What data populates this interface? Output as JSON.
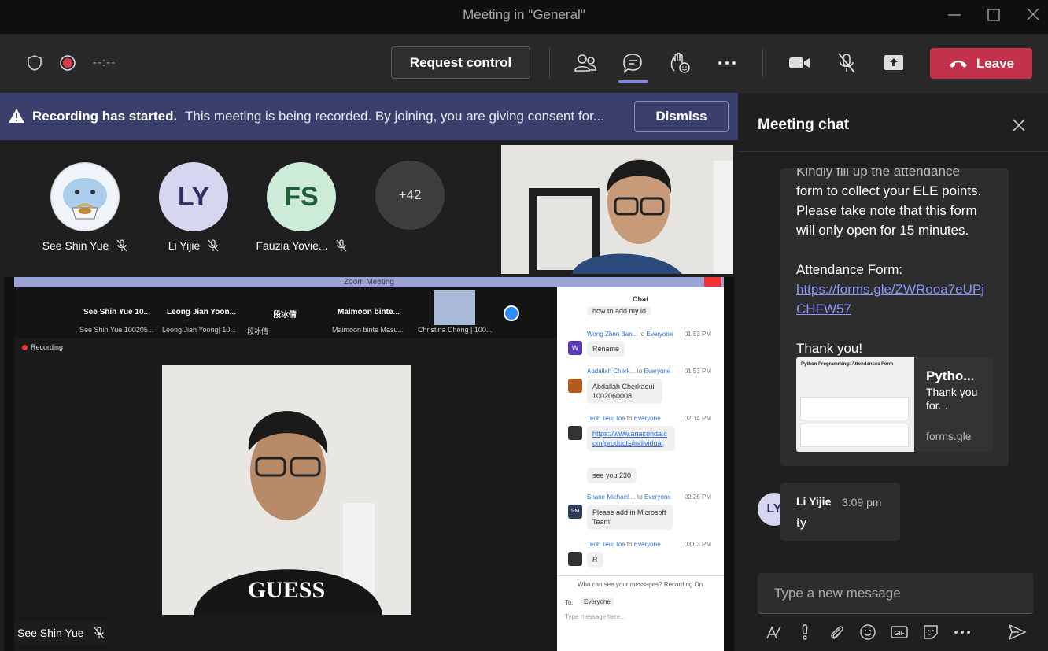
{
  "window": {
    "title": "Meeting in \"General\""
  },
  "toolbar": {
    "timer": "--:--",
    "request_control_label": "Request control",
    "leave_label": "Leave"
  },
  "banner": {
    "title": "Recording has started.",
    "message": "This meeting is being recorded. By joining, you are giving consent for...",
    "dismiss_label": "Dismiss"
  },
  "participants": [
    {
      "name": "See Shin Yue",
      "initials": "",
      "color": "#e9eef7"
    },
    {
      "name": "Li Yijie",
      "initials": "LY",
      "color": "#d7d6f0"
    },
    {
      "name": "Fauzia Yovie...",
      "initials": "FS",
      "color": "#cdebd9"
    },
    {
      "name": "",
      "initials": "+42",
      "color": "#3d3d3d"
    }
  ],
  "shared_screen": {
    "window_title": "Zoom Meeting",
    "recording_label": "Recording",
    "strip": [
      {
        "name": "See Shin Yue 10...",
        "sub": "See Shin Yue 100205..."
      },
      {
        "name": "Leong Jian Yoon...",
        "sub": "Leong Jian Yoong| 10..."
      },
      {
        "name": "段冰倩",
        "sub": "段冰倩"
      },
      {
        "name": "Maimoon binte...",
        "sub": "Maimoon binte Masu..."
      },
      {
        "name": "",
        "sub": "Christina Chong | 100..."
      }
    ],
    "chat": {
      "header": "Chat",
      "top_partial": "how to add my id",
      "messages": [
        {
          "sender": "Wong Zhen Ban...",
          "to": "to",
          "target": "Everyone",
          "time": "01:53 PM",
          "text": "Rename"
        },
        {
          "sender": "Abdallah Cherk...",
          "to": "to",
          "target": "Everyone",
          "time": "01:53 PM",
          "text": "Abdallah Cherkaoui 1002060008"
        },
        {
          "sender": "Teoh Teik Toe",
          "to": "to",
          "target": "Everyone",
          "time": "02:14 PM",
          "text": "https://www.anaconda.com/products/individual",
          "text2": "see you 230"
        },
        {
          "sender": "Shane Michael ...",
          "to": "to",
          "target": "Everyone",
          "time": "02:26 PM",
          "text": "Please add in Microsoft Team"
        },
        {
          "sender": "Teoh Teik Toe",
          "to": "to",
          "target": "Everyone",
          "time": "03:03 PM",
          "text": "R"
        }
      ],
      "visibility_note": "Who can see your messages? Recording On",
      "to_label": "To:",
      "to_value": "Everyone",
      "input_placeholder": "Type message here..."
    },
    "speaker_label": "See Shin Yue"
  },
  "meeting_chat": {
    "header": "Meeting chat",
    "message_lines": [
      "Kindly fill up the attendance",
      "form to collect your ELE points.",
      "Please take note that this form",
      "will only open for 15 minutes.",
      "",
      "Attendance Form:"
    ],
    "link_lines": [
      "https://forms.gle/ZWRooa7eUPj",
      "CHFW57"
    ],
    "thanks": "Thank you!",
    "preview": {
      "title": "Pytho...",
      "desc": "Thank you for...",
      "url": "forms.gle",
      "thumb_title": "Python Programming: Attendances Form"
    },
    "reply": {
      "initials": "LY",
      "name": "Li Yijie",
      "time": "3:09 pm",
      "text": "ty"
    },
    "compose_placeholder": "Type a new message"
  },
  "colors": {
    "accent": "#7f85f5",
    "leave": "#c4314b",
    "banner": "#3b3f6b",
    "link": "#8f95ff"
  }
}
